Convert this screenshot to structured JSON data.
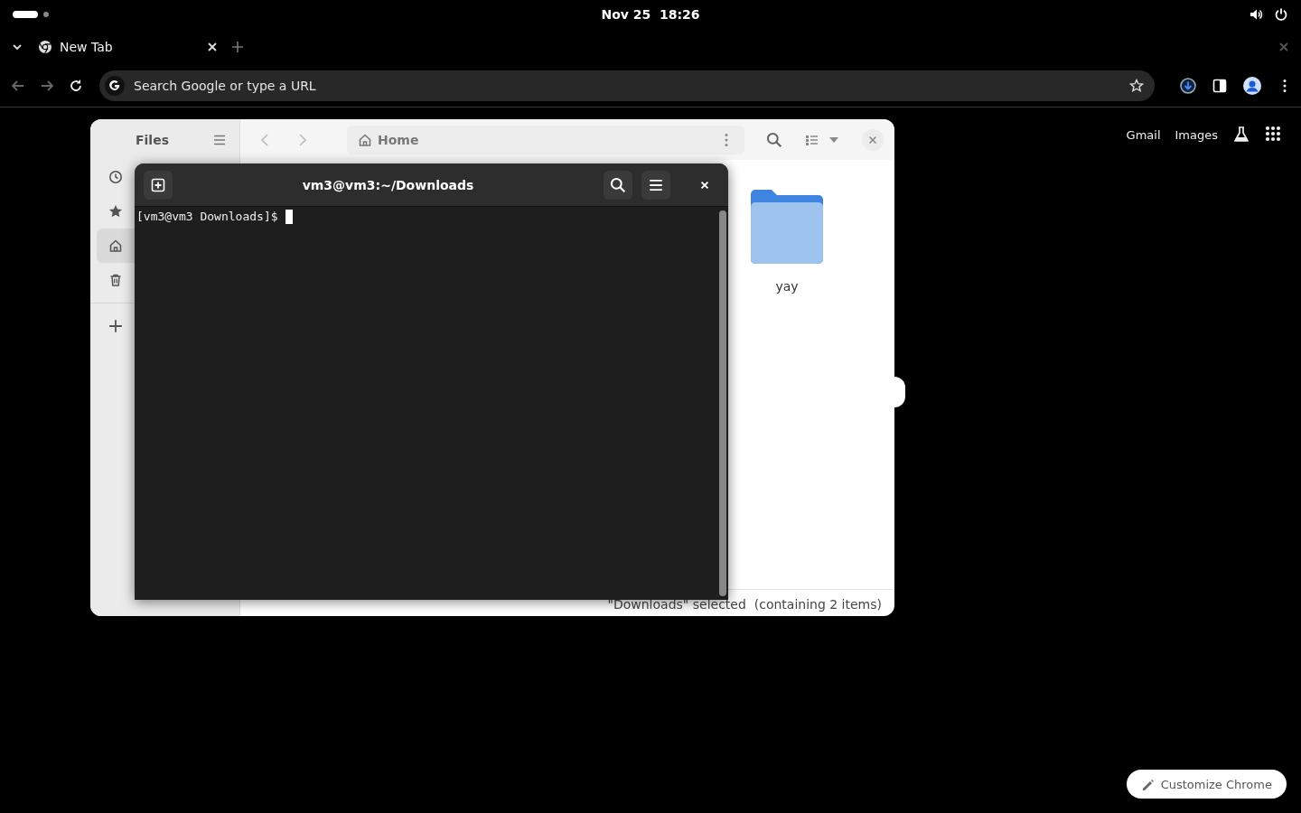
{
  "top_bar": {
    "clock": "Nov 25  18:26"
  },
  "browser": {
    "tabs": [
      {
        "label": "New Tab",
        "selected": true
      }
    ],
    "address_bar": {
      "placeholder": "Search Google or type a URL"
    },
    "links": [
      "Gmail",
      "Images"
    ],
    "customize_button": "Customize Chrome"
  },
  "files_window": {
    "title": "Files",
    "path": "Home",
    "sidebar": {
      "items": [
        {
          "kind": "recent",
          "selected": false
        },
        {
          "kind": "starred",
          "selected": false
        },
        {
          "kind": "home",
          "selected": true
        },
        {
          "kind": "trash",
          "selected": false
        },
        {
          "kind": "other-locations",
          "selected": false
        }
      ]
    },
    "items": [
      {
        "name": "yay"
      }
    ],
    "status": "\"Downloads\" selected  (containing 2 items)"
  },
  "terminal": {
    "title": "vm3@vm3:~/Downloads",
    "prompt": "[vm3@vm3 Downloads]$"
  }
}
